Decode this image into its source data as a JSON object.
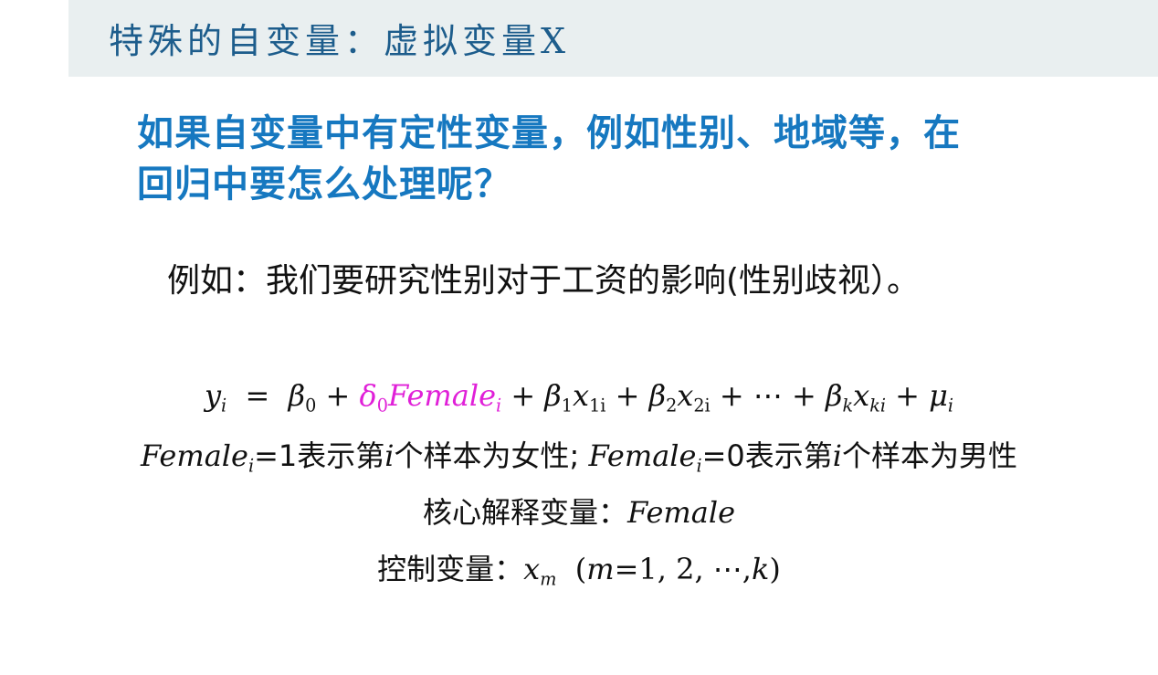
{
  "slide": {
    "title": "特殊的自变量：虚拟变量X",
    "question_line1": "如果自变量中有定性变量，例如性别、地域等，在",
    "question_line2": "回归中要怎么处理呢？",
    "example": "例如：我们要研究性别对于工资的影响(性别歧视）。"
  },
  "formulas": {
    "eq_y": "y",
    "eq_i": "i",
    "eq_equals": "=",
    "beta": "β",
    "sub0": "0",
    "plus": "+",
    "delta": "δ",
    "female": "Female",
    "x": "x",
    "sub1": "1",
    "sub2": "2",
    "sub1i": "1i",
    "sub2i": "2i",
    "dots": "⋯",
    "subk": "k",
    "subki": "ki",
    "mu": "μ",
    "one_desc": "=1表示第",
    "sample_female": "个样本为女性;",
    "zero_desc": "=0表示第",
    "sample_male": "个样本为男性",
    "core_label": "核心解释变量：",
    "control_label": "控制变量：",
    "subm": "m",
    "range_open": "(",
    "range_m": "m",
    "range_rest": "=1, 2, ⋯,",
    "range_k": "k",
    "range_close": ")"
  }
}
